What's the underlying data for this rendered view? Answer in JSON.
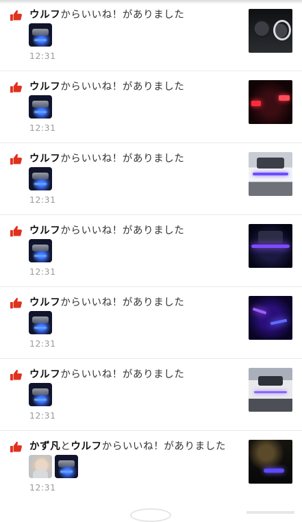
{
  "notifications": [
    {
      "users": [
        "ウルフ"
      ],
      "connector": "",
      "text": "からいいね！がありました",
      "time": "12:31",
      "avatars": [
        "car-avatar"
      ],
      "thumbnail": "dashboard-photo"
    },
    {
      "users": [
        "ウルフ"
      ],
      "connector": "",
      "text": "からいいね！がありました",
      "time": "12:31",
      "avatars": [
        "car-avatar"
      ],
      "thumbnail": "taillight-photo"
    },
    {
      "users": [
        "ウルフ"
      ],
      "connector": "",
      "text": "からいいね！がありました",
      "time": "12:31",
      "avatars": [
        "car-avatar"
      ],
      "thumbnail": "car-front-photo"
    },
    {
      "users": [
        "ウルフ"
      ],
      "connector": "",
      "text": "からいいね！がありました",
      "time": "12:31",
      "avatars": [
        "car-avatar"
      ],
      "thumbnail": "car-night-photo"
    },
    {
      "users": [
        "ウルフ"
      ],
      "connector": "",
      "text": "からいいね！がありました",
      "time": "12:31",
      "avatars": [
        "car-avatar"
      ],
      "thumbnail": "purple-light-photo"
    },
    {
      "users": [
        "ウルフ"
      ],
      "connector": "",
      "text": "からいいね！がありました",
      "time": "12:31",
      "avatars": [
        "car-avatar"
      ],
      "thumbnail": "car-street-photo"
    },
    {
      "users": [
        "かず凡",
        "ウルフ"
      ],
      "connector": "と",
      "text": "からいいね！がありました",
      "time": "12:31",
      "avatars": [
        "person-avatar",
        "car-avatar"
      ],
      "thumbnail": "car-tree-night-photo"
    }
  ],
  "colors": {
    "like_icon": "#e0301e",
    "time_text": "#9a9a9a",
    "divider": "#e9e9e9"
  },
  "icons": {
    "like": "thumbs-up-icon"
  }
}
